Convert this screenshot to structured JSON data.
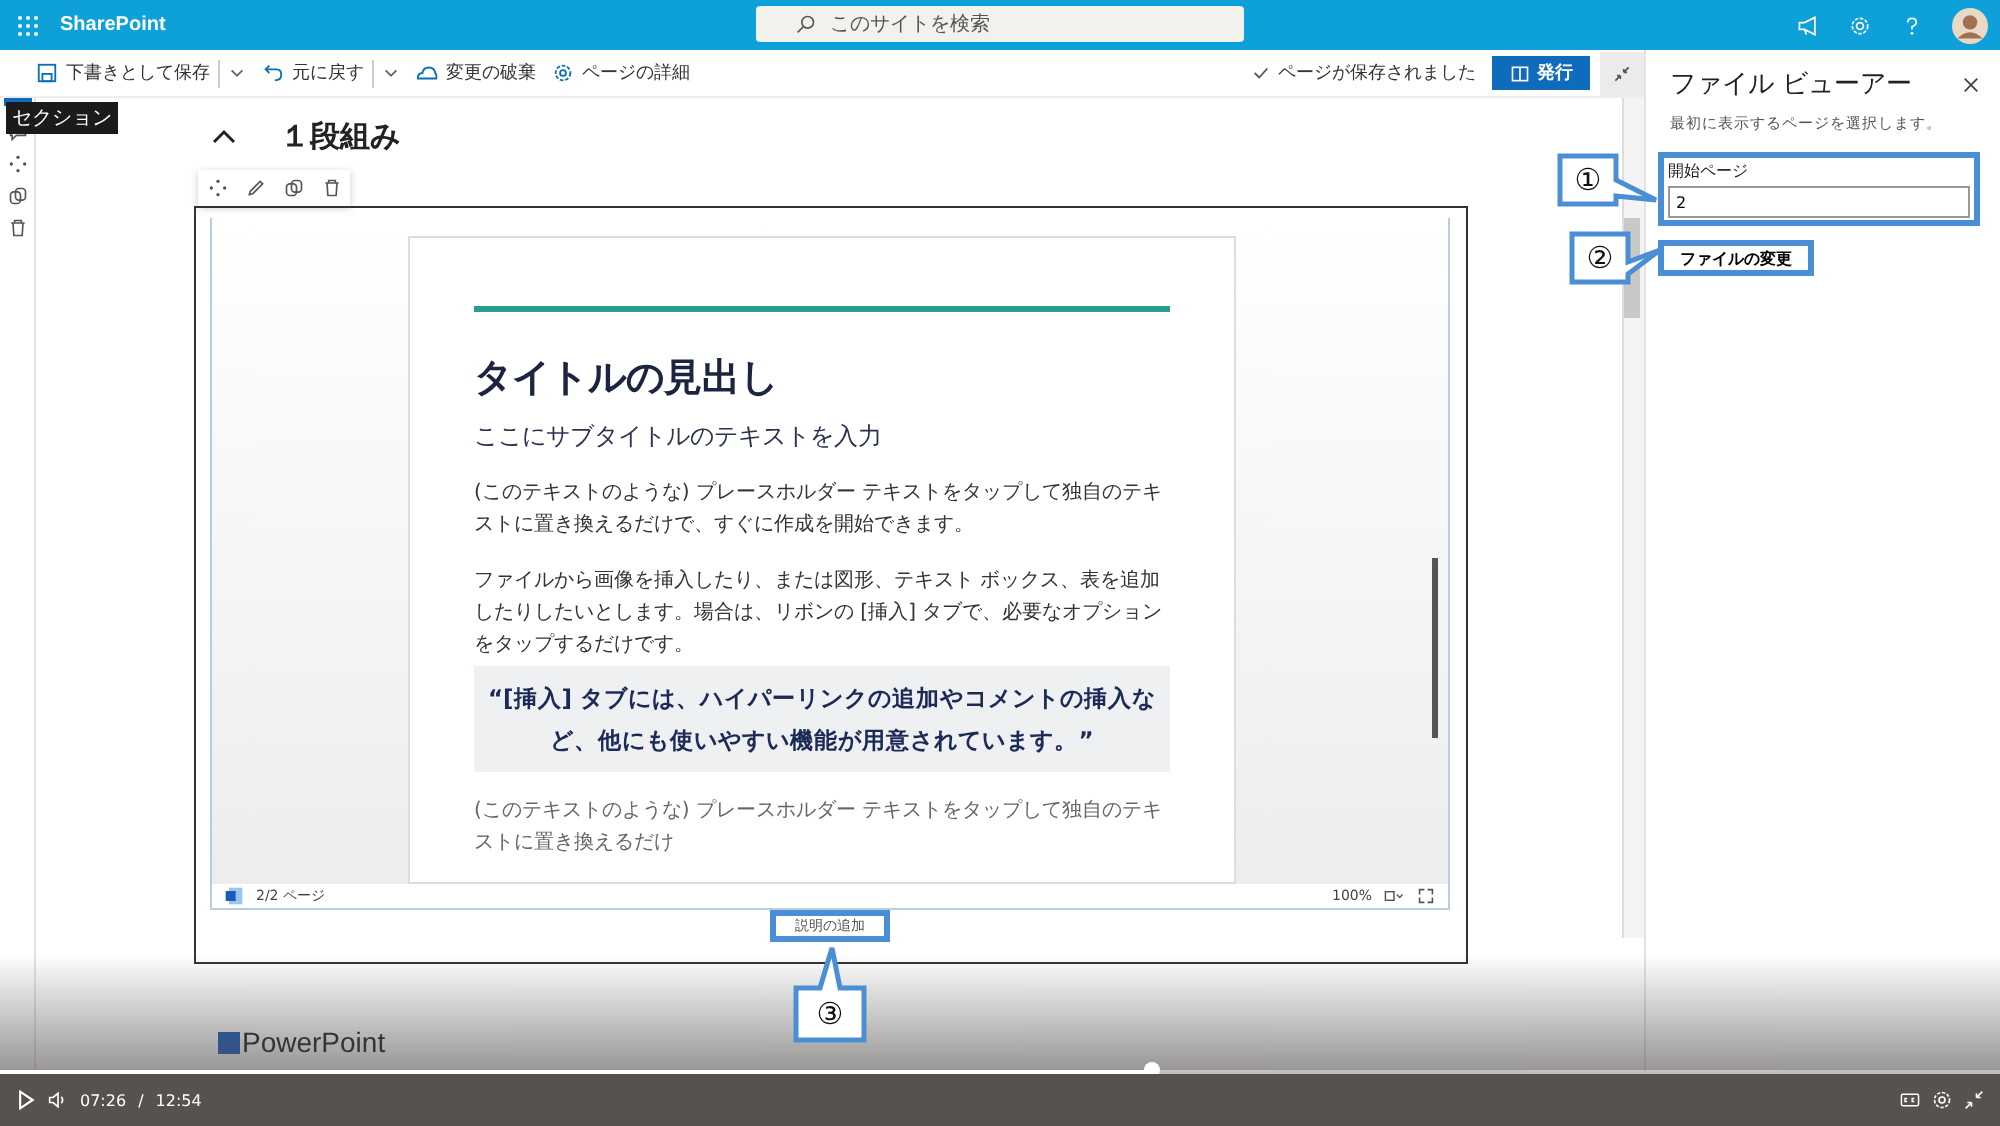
{
  "top_bar": {
    "site_name": "SharePoint",
    "search": {
      "placeholder": "このサイトを検索"
    }
  },
  "command_bar": {
    "items": [
      {
        "kind": "save",
        "label": "下書きとして保存",
        "dropdown": true
      },
      {
        "kind": "undo",
        "label": "元に戻す",
        "dropdown": true
      },
      {
        "kind": "discard",
        "label": "変更の破棄",
        "dropdown": false
      },
      {
        "kind": "details",
        "label": "ページの詳細",
        "dropdown": false
      }
    ],
    "status": "ページが保存されました",
    "publish": "発行"
  },
  "left_rail": {
    "tooltip": "セクション"
  },
  "section": {
    "heading": "１段組み"
  },
  "viewer": {
    "document": {
      "title": "タイトルの見出し",
      "subtitle": "ここにサブタイトルのテキストを入力",
      "paragraphs": [
        "(このテキストのような) プレースホルダー テキストをタップして独自のテキストに置き換えるだけで、すぐに作成を開始できます。",
        "ファイルから画像を挿入したり、または図形、テキスト ボックス、表を追加したりしたいとします。場合は、リボンの [挿入] タブで、必要なオプションをタップするだけです。"
      ],
      "quote": "“[挿入] タブには、ハイパーリンクの追加やコメントの挿入など、他にも使いやすい機能が用意されています。”",
      "trailing": "(このテキストのような) プレースホルダー テキストをタップして独自のテキストに置き換えるだけ"
    },
    "page_indicator": "2/2 ページ",
    "zoom": "100%",
    "caption_placeholder": "説明の追加"
  },
  "web_part_label": "PowerPoint",
  "panel": {
    "title": "ファイル ビューアー",
    "description": "最初に表示するページを選択します。",
    "field": {
      "label": "開始ページ",
      "value": "2"
    },
    "button": "ファイルの変更"
  },
  "annotations": [
    {
      "label": "①"
    },
    {
      "label": "②"
    },
    {
      "label": "③"
    }
  ],
  "video": {
    "current": "07:26",
    "separator": "/",
    "duration": "12:54",
    "progress": {
      "level": 0.576
    }
  }
}
